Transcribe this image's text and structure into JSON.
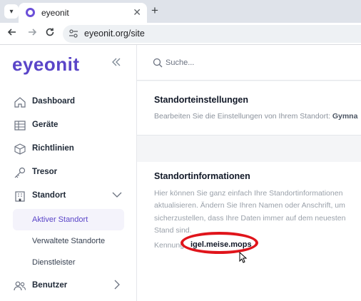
{
  "browser": {
    "tab_title": "eyeonit",
    "tab_close": "✕",
    "new_tab": "+",
    "url": "eyeonit.org/site"
  },
  "sidebar": {
    "logo": "eyeonit",
    "collapse_icon": "chevrons-left-icon",
    "items": [
      {
        "label": "Dashboard",
        "icon": "home-icon"
      },
      {
        "label": "Geräte",
        "icon": "table-icon"
      },
      {
        "label": "Richtlinien",
        "icon": "cube-icon"
      },
      {
        "label": "Tresor",
        "icon": "key-icon"
      },
      {
        "label": "Standort",
        "icon": "building-icon",
        "expanded": true
      },
      {
        "label": "Benutzer",
        "icon": "users-icon"
      }
    ],
    "subitems": [
      {
        "label": "Aktiver Standort",
        "active": true
      },
      {
        "label": "Verwaltete Standorte"
      },
      {
        "label": "Dienstleister"
      }
    ]
  },
  "search": {
    "placeholder": "Suche..."
  },
  "settings_card": {
    "title": "Standorteinstellungen",
    "subtitle_prefix": "Bearbeiten Sie die Einstellungen von Ihrem Standort: ",
    "subtitle_bold": "Gymna"
  },
  "info_card": {
    "title": "Standortinformationen",
    "description": "Hier können Sie ganz einfach Ihre Standortinformationen aktualisieren. Ändern Sie Ihren Namen oder Anschrift, um sicherzustellen, dass Ihre Daten immer auf dem neuesten Stand sind.",
    "kennung_label": "Kennung",
    "kennung_value": "igel.meise.mops"
  },
  "colors": {
    "brand": "#5a45c8",
    "annotation_red": "#e0141b"
  }
}
